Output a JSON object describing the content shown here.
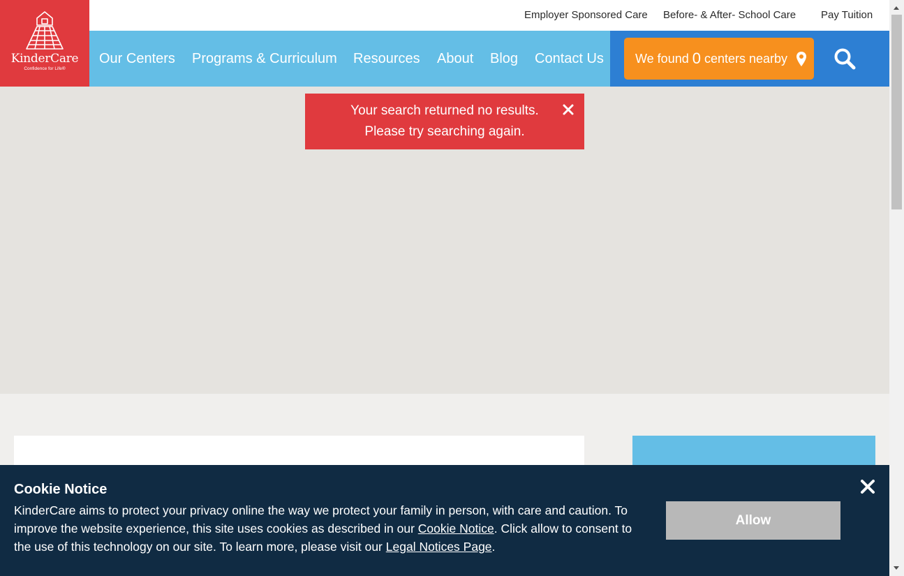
{
  "brand": {
    "name": "KinderCare",
    "tagline": "Confidence for Life®",
    "color": "#e03a3e"
  },
  "utility_nav": {
    "items": [
      "Employer Sponsored Care",
      "Before- & After- School Care",
      "Pay Tuition"
    ]
  },
  "main_nav": {
    "items": [
      "Our Centers",
      "Programs & Curriculum",
      "Resources",
      "About",
      "Blog",
      "Contact Us"
    ],
    "color": "#64bee6"
  },
  "centers_nearby": {
    "prefix": "We found",
    "count": "0",
    "suffix": "centers nearby",
    "color": "#f7901e",
    "icon": "map-pin-icon"
  },
  "search": {
    "icon": "search-icon"
  },
  "alert": {
    "line1": "Your search returned no results.",
    "line2": "Please try searching again.",
    "close_icon": "close-icon"
  },
  "cookie_notice": {
    "title": "Cookie Notice",
    "text_before_link1": "KinderCare aims to protect your privacy online the way we protect your family in person, with care and caution. To improve the website experience, this site uses cookies as described in our ",
    "link1": "Cookie Notice",
    "text_between": ". Click allow to consent to the use of this technology on our site. To learn more, please visit our ",
    "link2": "Legal Notices Page",
    "text_after": ".",
    "allow_label": "Allow",
    "close_icon": "close-icon",
    "background": "#102b43"
  }
}
